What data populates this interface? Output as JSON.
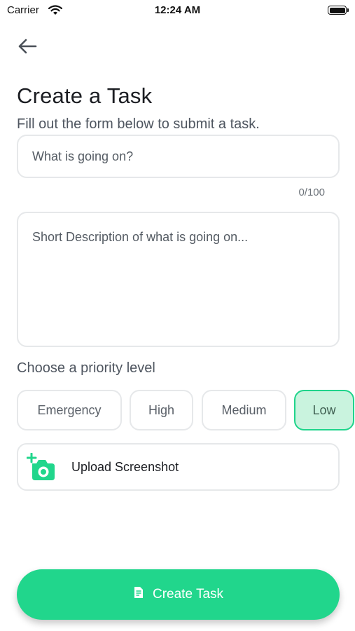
{
  "status_bar": {
    "carrier": "Carrier",
    "time": "12:24 AM"
  },
  "header": {
    "back_icon": "arrow-left-icon",
    "title": "Create a Task",
    "subtitle": "Fill out the form below to submit a task."
  },
  "form": {
    "title_field": {
      "value": "",
      "placeholder": "What is going on?"
    },
    "char_counter": "0/100",
    "description_field": {
      "value": "",
      "placeholder": "Short Description of what is going on..."
    }
  },
  "priority": {
    "label": "Choose a priority level",
    "options": [
      "Emergency",
      "High",
      "Medium",
      "Low"
    ],
    "selected": "Low"
  },
  "upload": {
    "icon": "add-camera-icon",
    "label": "Upload Screenshot"
  },
  "submit": {
    "icon": "document-icon",
    "label": "Create Task"
  },
  "colors": {
    "accent": "#21d68c",
    "selected_chip_bg": "#c9f3de",
    "border": "#e6e8ea"
  }
}
